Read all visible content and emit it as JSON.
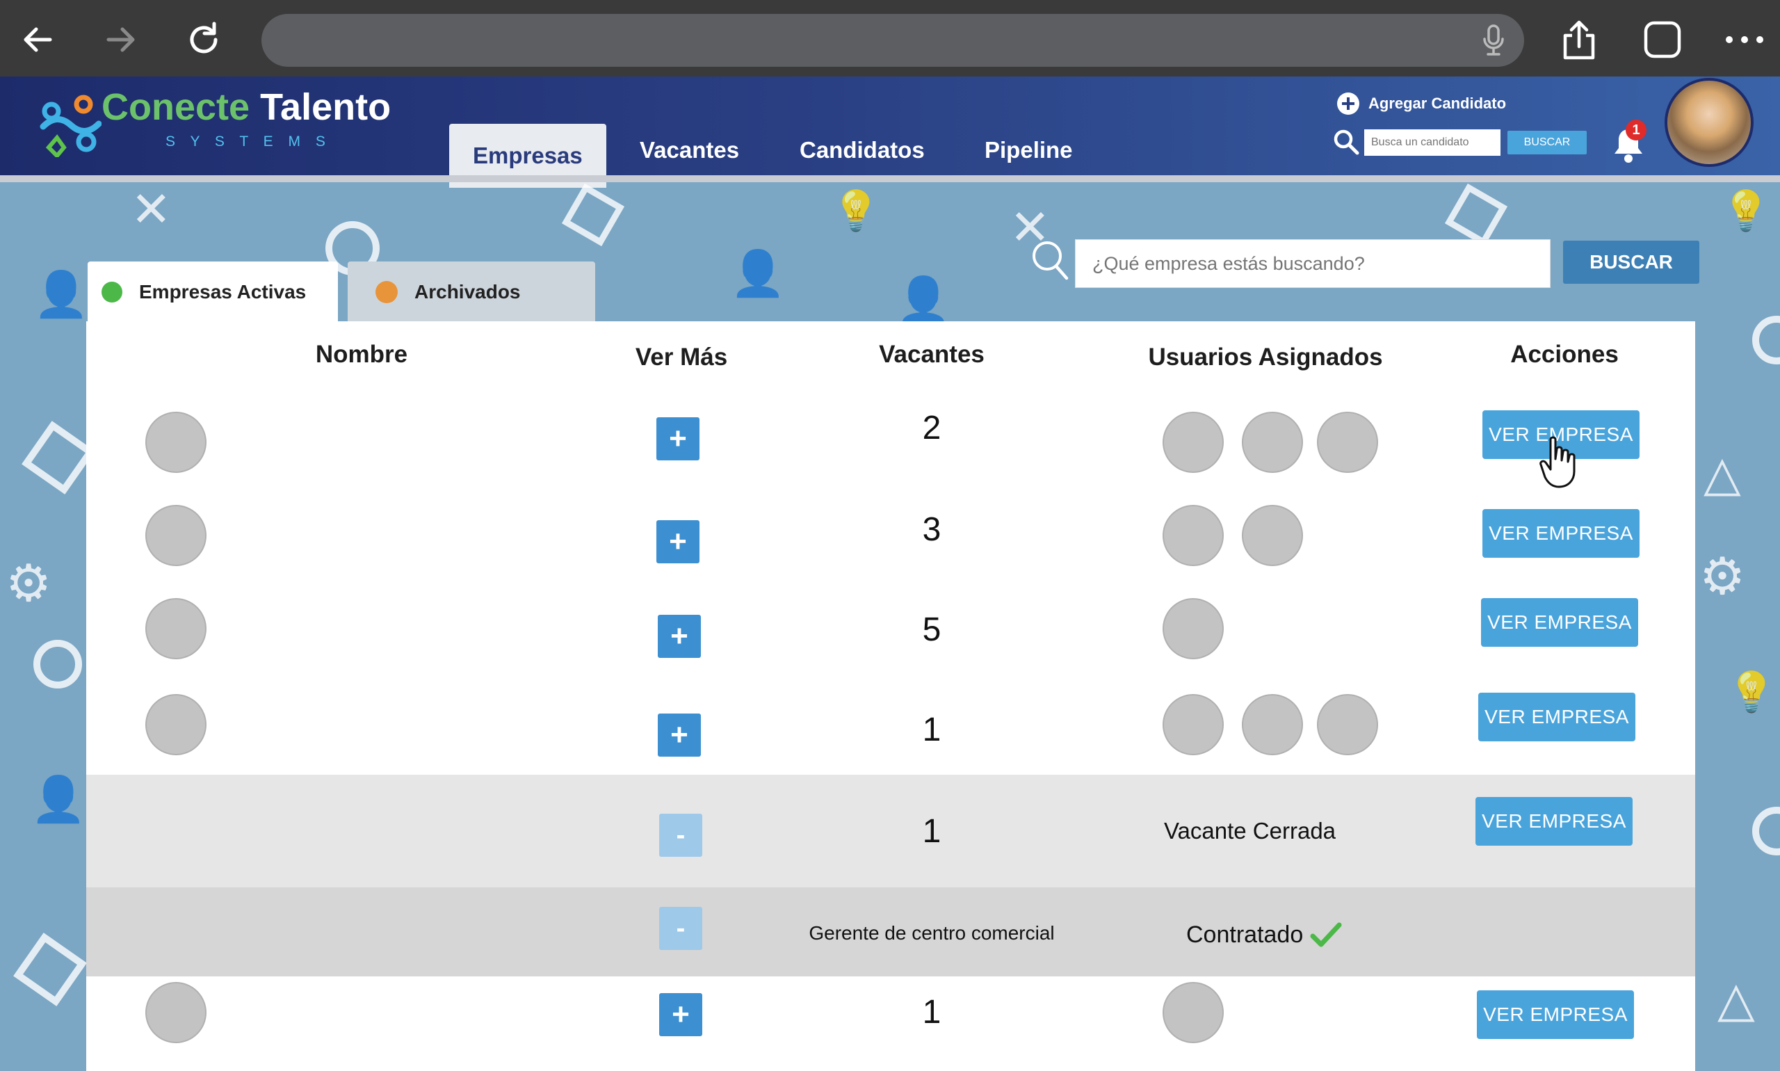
{
  "brand": {
    "name_part1": "Conecte",
    "name_part2": "Talento",
    "tagline": "S Y S T E M S"
  },
  "nav": {
    "tabs": [
      {
        "label": "Empresas",
        "active": true
      },
      {
        "label": "Vacantes"
      },
      {
        "label": "Candidatos"
      },
      {
        "label": "Pipeline"
      }
    ]
  },
  "header_tools": {
    "add_candidate": "Agregar Candidato",
    "search_placeholder": "Busca un candidato",
    "search_button": "BUSCAR",
    "notification_count": "1"
  },
  "company_search": {
    "placeholder": "¿Qué empresa estás buscando?",
    "button": "BUSCAR"
  },
  "filter_tabs": {
    "active": "Empresas Activas",
    "archived": "Archivados"
  },
  "columns": {
    "nombre": "Nombre",
    "ver_mas": "Ver Más",
    "vacantes": "Vacantes",
    "usuarios": "Usuarios Asignados",
    "acciones": "Acciones"
  },
  "rows": [
    {
      "vacantes": "2",
      "users": 3,
      "action": "VER EMPRESA"
    },
    {
      "vacantes": "3",
      "users": 2,
      "action": "VER EMPRESA"
    },
    {
      "vacantes": "5",
      "users": 1,
      "action": "VER EMPRESA"
    },
    {
      "vacantes": "1",
      "users": 3,
      "action": "VER EMPRESA"
    },
    {
      "vacantes": "1",
      "status": "Vacante Cerrada",
      "action": "VER EMPRESA"
    },
    {
      "position": "Gerente de centro comercial",
      "status": "Contratado"
    },
    {
      "vacantes": "1",
      "users": 1,
      "action": "VER EMPRESA"
    }
  ],
  "colors": {
    "accent": "#4aa4dc",
    "header_dark": "#1d2b6b",
    "active_dot": "#4cb848",
    "archived_dot": "#e8943a",
    "check": "#4cb848"
  }
}
